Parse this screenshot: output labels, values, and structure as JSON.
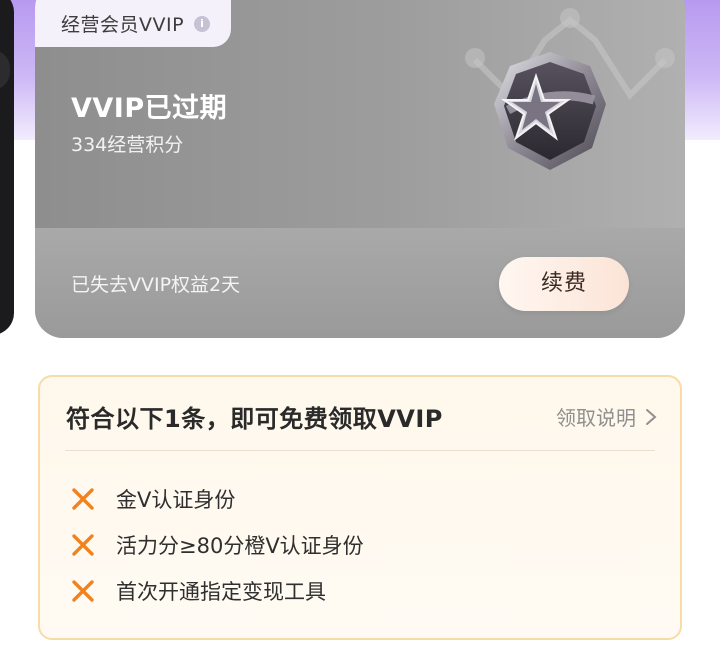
{
  "vip_card": {
    "tag_label": "经营会员VVIP",
    "info_icon": "i",
    "status_title": "VVIP已过期",
    "points_text": "334经营积分",
    "medal_level": "I",
    "lost_text": "已失去VVIP权益2天",
    "renew_button": "续费"
  },
  "conditions": {
    "title": "符合以下1条，即可免费领取VVIP",
    "explain_link": "领取说明",
    "items": [
      {
        "text": "金V认证身份",
        "status_icon": "cross-icon"
      },
      {
        "text": "活力分≥80分橙V认证身份",
        "status_icon": "cross-icon"
      },
      {
        "text": "首次开通指定变现工具",
        "status_icon": "cross-icon"
      }
    ]
  },
  "colors": {
    "accent_orange": "#f0831f",
    "card_gray": "#9b9b9b",
    "condition_border": "#f7dca6",
    "purple_bg": "#b79af0"
  }
}
